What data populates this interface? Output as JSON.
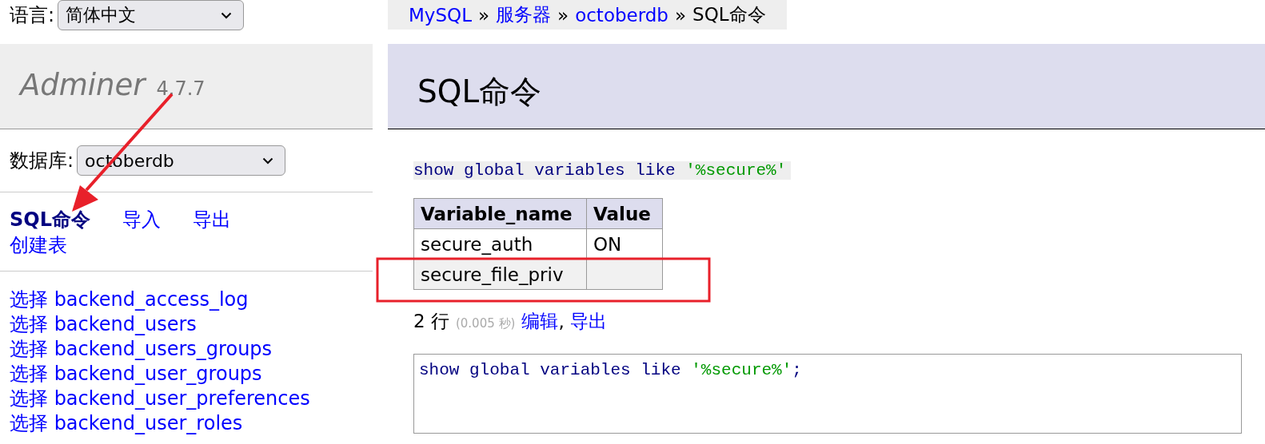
{
  "language": {
    "label": "语言:",
    "value": "简体中文"
  },
  "logo": {
    "name": "Adminer",
    "version": "4.7.7"
  },
  "database": {
    "label": "数据库:",
    "value": "octoberdb"
  },
  "links": [
    {
      "text": "SQL命令",
      "selected": true
    },
    {
      "text": "导入",
      "selected": false
    },
    {
      "text": "导出",
      "selected": false
    },
    {
      "text": "创建表",
      "selected": false
    }
  ],
  "tables": [
    {
      "action": "选择",
      "name": "backend_access_log"
    },
    {
      "action": "选择",
      "name": "backend_users"
    },
    {
      "action": "选择",
      "name": "backend_users_groups"
    },
    {
      "action": "选择",
      "name": "backend_user_groups"
    },
    {
      "action": "选择",
      "name": "backend_user_preferences"
    },
    {
      "action": "选择",
      "name": "backend_user_roles"
    }
  ],
  "breadcrumb": [
    {
      "text": "MySQL",
      "kind": "link"
    },
    {
      "text": "»",
      "kind": "separator"
    },
    {
      "text": "服务器",
      "kind": "link"
    },
    {
      "text": "»",
      "kind": "separator"
    },
    {
      "text": "octoberdb",
      "kind": "link"
    },
    {
      "text": "»",
      "kind": "separator"
    },
    {
      "text": "SQL命令",
      "kind": "current"
    }
  ],
  "heading": "SQL命令",
  "query": [
    {
      "text": "show global variables like ",
      "kind": "keyword"
    },
    {
      "text": "'%secure%'",
      "kind": "string"
    }
  ],
  "result": {
    "columns": [
      "Variable_name",
      "Value"
    ],
    "rows": [
      {
        "cells": [
          "secure_auth",
          "ON"
        ],
        "selected": false
      },
      {
        "cells": [
          "secure_file_priv",
          ""
        ],
        "selected": true
      }
    ]
  },
  "summary": {
    "rows": "2 行",
    "time": "(0.005 秒)",
    "links": [
      {
        "text": "编辑",
        "kind": "link"
      },
      {
        "text": ",",
        "kind": "separator"
      },
      {
        "text": "导出",
        "kind": "link"
      }
    ]
  },
  "editor": [
    {
      "text": "show global variables like ",
      "kind": "keyword"
    },
    {
      "text": "'%secure%'",
      "kind": "string"
    },
    {
      "text": ";",
      "kind": "punct"
    }
  ]
}
